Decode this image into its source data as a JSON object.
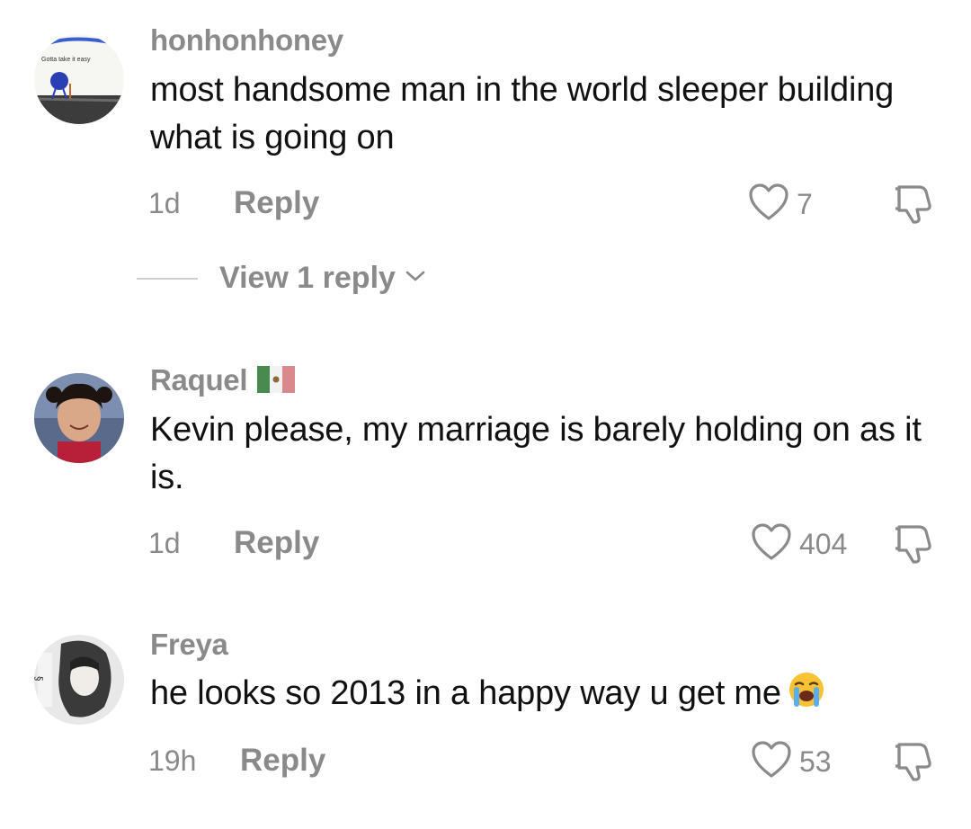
{
  "comments": [
    {
      "username": "honhonhoney",
      "text": "most handsome man in the world sleeper building what is going on",
      "time": "1d",
      "reply_label": "Reply",
      "likes": "7",
      "avatar_caption": "Gotta take it easy",
      "view_replies_label": "View 1 reply"
    },
    {
      "username": "Raquel",
      "flag": "mexico-flag",
      "text": "Kevin please, my marriage is barely holding on as it is.",
      "time": "1d",
      "reply_label": "Reply",
      "likes": "404"
    },
    {
      "username": "Freya",
      "text": "he looks so 2013 in a happy way u get me",
      "emoji": "loudly-crying-face",
      "time": "19h",
      "reply_label": "Reply",
      "likes": "53"
    }
  ],
  "icons": {
    "like": "heart-outline-icon",
    "dislike": "thumbs-down-icon",
    "chevron": "chevron-down-icon"
  },
  "colors": {
    "text": "#111111",
    "muted": "#8a8a8a",
    "divider": "#cfcfcf"
  }
}
